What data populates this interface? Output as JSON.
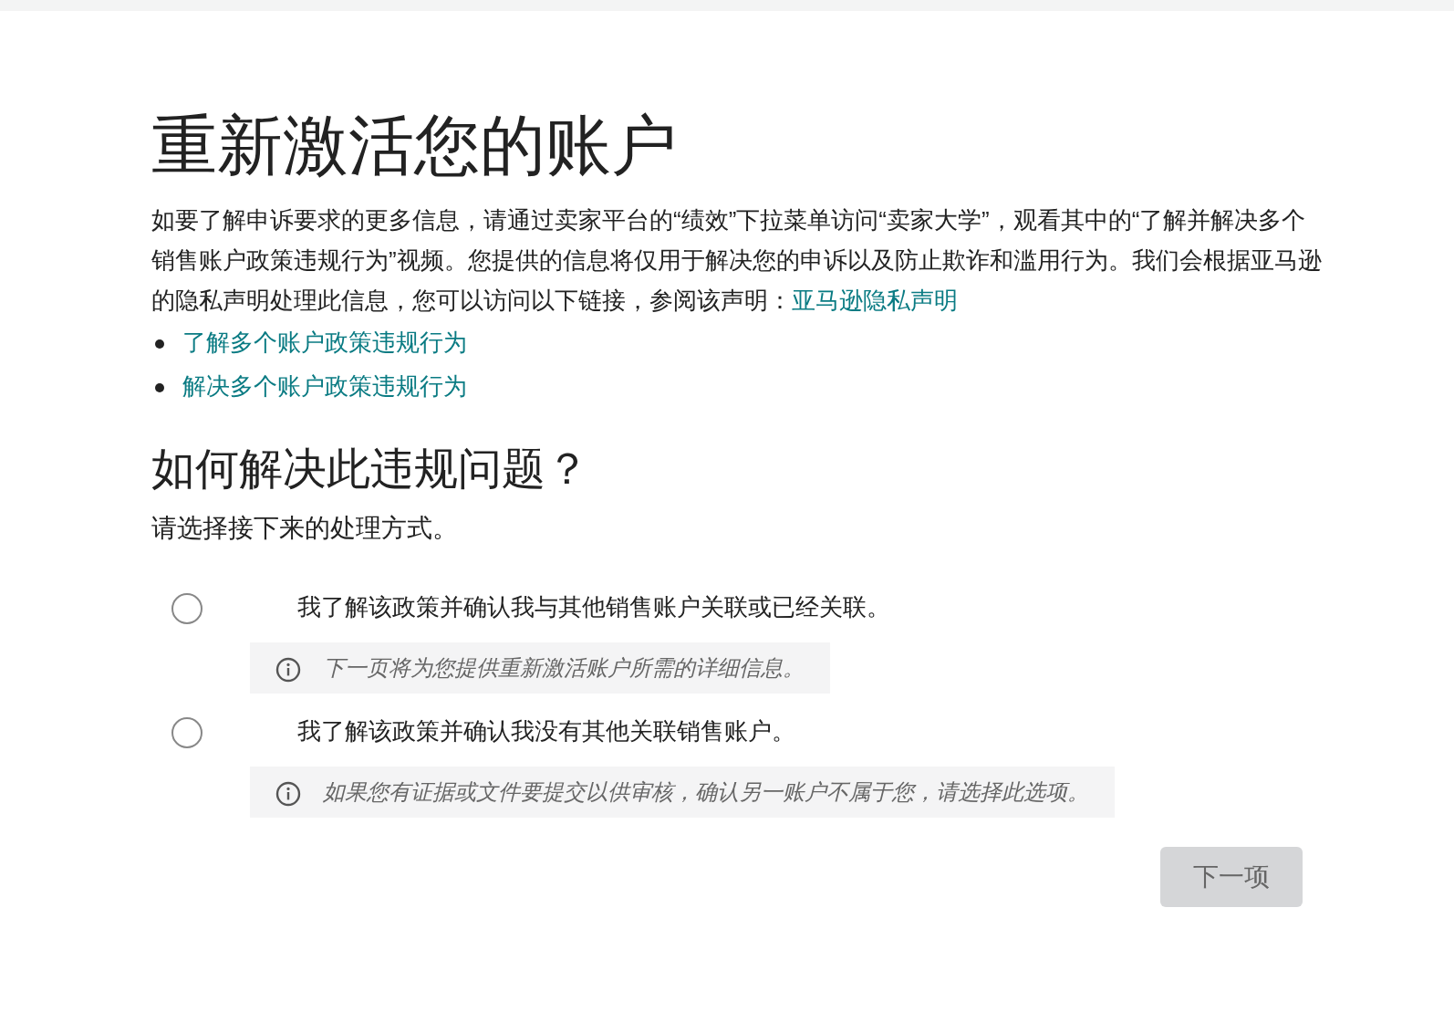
{
  "title": "重新激活您的账户",
  "intro": {
    "text": "如要了解申诉要求的更多信息，请通过卖家平台的“绩效”下拉菜单访问“卖家大学”，观看其中的“了解并解决多个销售账户政策违规行为”视频。您提供的信息将仅用于解决您的申诉以及防止欺诈和滥用行为。我们会根据亚马逊的隐私声明处理此信息，您可以访问以下链接，参阅该声明：",
    "link": "亚马逊隐私声明"
  },
  "links": [
    "了解多个账户政策违规行为",
    "解决多个账户政策违规行为"
  ],
  "question": "如何解决此违规问题？",
  "instruction": "请选择接下来的处理方式。",
  "options": [
    {
      "label": "我了解该政策并确认我与其他销售账户关联或已经关联。",
      "selected": false,
      "info": "下一页将为您提供重新激活账户所需的详细信息。"
    },
    {
      "label": "我了解该政策并确认我没有其他关联销售账户。",
      "selected": false,
      "info": "如果您有证据或文件要提交以供审核，确认另一账户不属于您，请选择此选项。"
    }
  ],
  "next_button": {
    "label": "下一项",
    "disabled": true
  }
}
